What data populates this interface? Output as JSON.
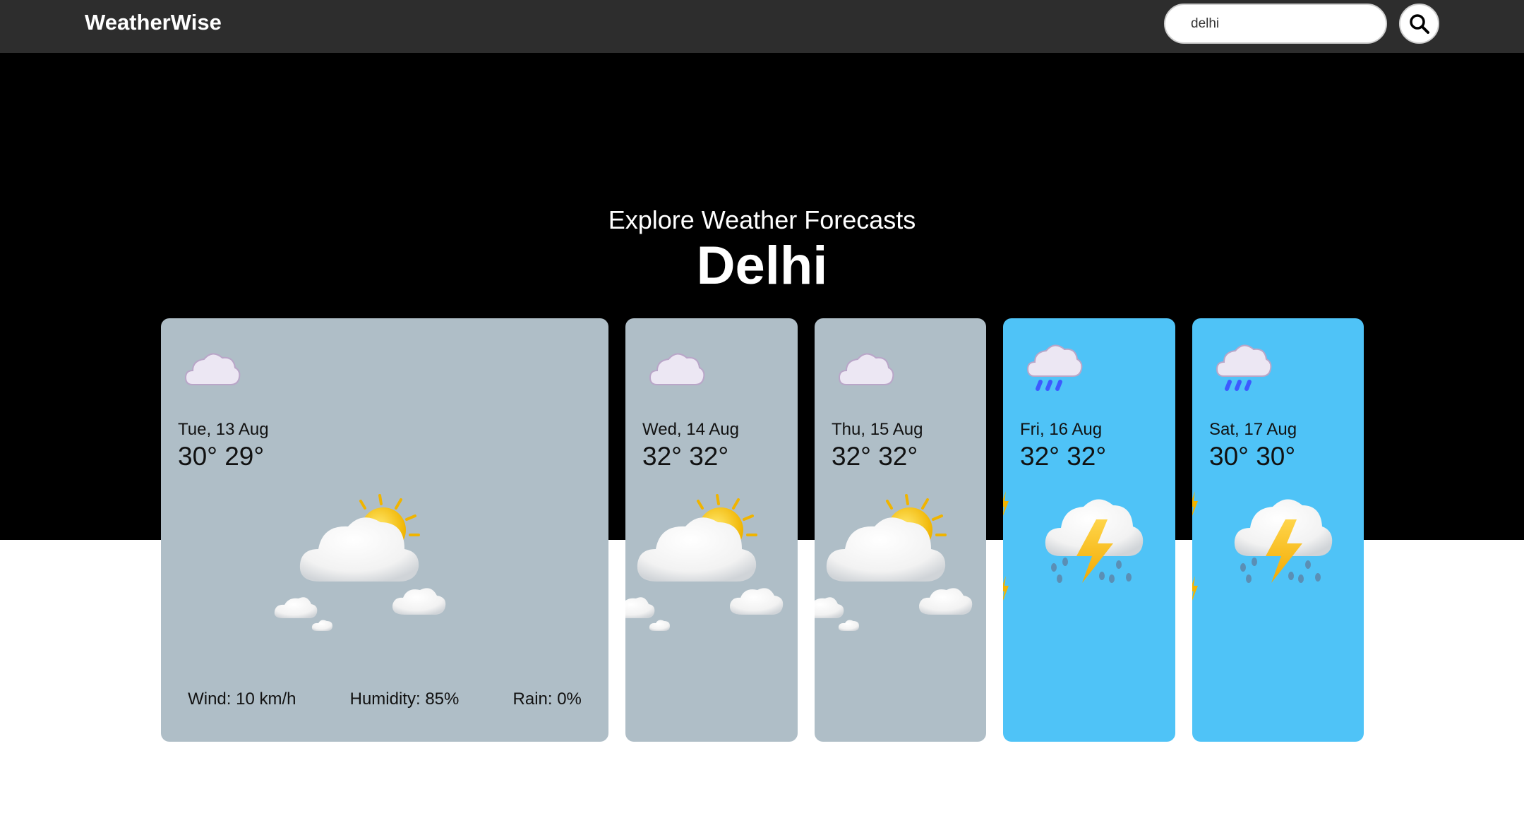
{
  "navbar": {
    "brand": "WeatherWise",
    "search": {
      "value": "delhi",
      "placeholder": ""
    },
    "search_icon": "search-icon"
  },
  "hero": {
    "subtitle": "Explore Weather Forecasts",
    "city": "Delhi"
  },
  "colors": {
    "navbar": "#2d2d2d",
    "hero": "#000000",
    "cloudy_card": "#afbec7",
    "storm_card": "#4fc3f7"
  },
  "forecast": [
    {
      "date": "Tue, 13 Aug",
      "temps": "30° 29°",
      "condition": "partly-cloudy",
      "icon": "cloud-icon",
      "wind": "Wind: 10 km/h",
      "humidity": "Humidity: 85%",
      "rain": "Rain: 0%"
    },
    {
      "date": "Wed, 14 Aug",
      "temps": "32° 32°",
      "condition": "partly-cloudy",
      "icon": "cloud-icon"
    },
    {
      "date": "Thu, 15 Aug",
      "temps": "32° 32°",
      "condition": "partly-cloudy",
      "icon": "cloud-icon"
    },
    {
      "date": "Fri, 16 Aug",
      "temps": "32° 32°",
      "condition": "thunderstorm",
      "icon": "rain-cloud-icon"
    },
    {
      "date": "Sat, 17 Aug",
      "temps": "30° 30°",
      "condition": "thunderstorm",
      "icon": "rain-cloud-icon"
    }
  ]
}
